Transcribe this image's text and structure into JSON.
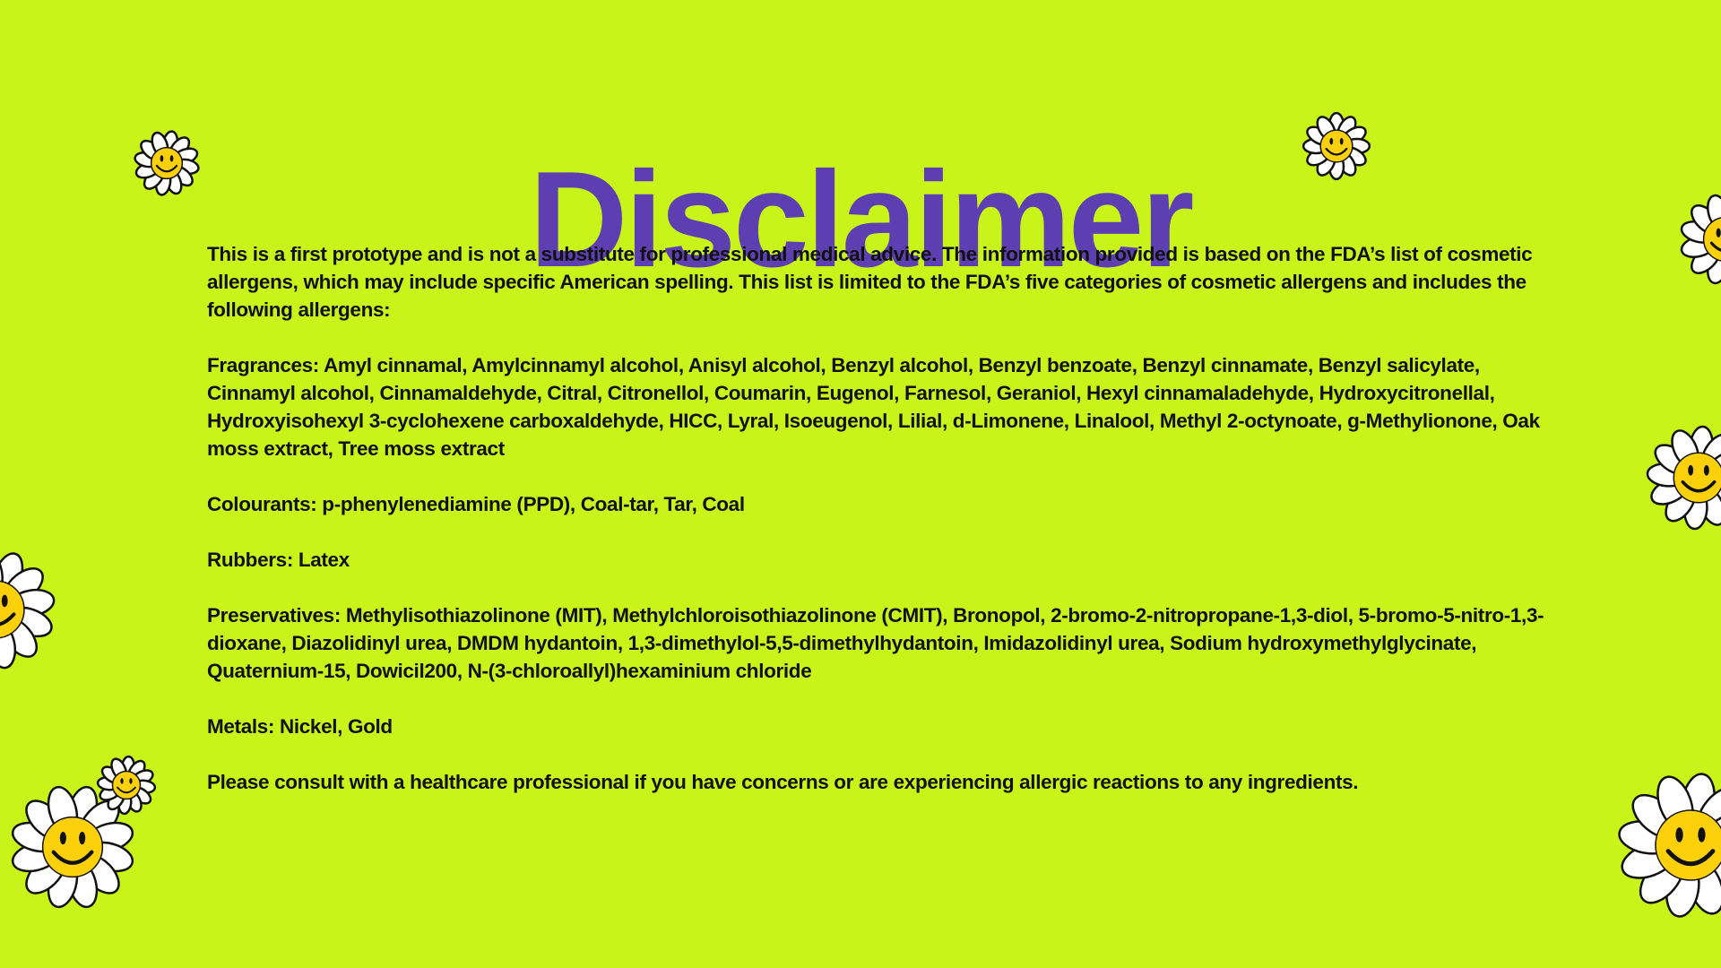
{
  "colors": {
    "background": "#c9f41a",
    "title": "#5d3fb2",
    "petal": "#ffffff",
    "outline": "#111111",
    "face": "#fcd10a"
  },
  "title": "Disclaimer",
  "paragraphs": [
    "This is a first prototype and is not a substitute for professional medical advice. The information provided is based on the FDA’s list of cosmetic allergens, which may include specific American spelling. This list is limited to the FDA’s five categories of cosmetic allergens and includes the following allergens:",
    "Fragrances: Amyl cinnamal, Amylcinnamyl alcohol, Anisyl alcohol, Benzyl alcohol, Benzyl benzoate, Benzyl cinnamate, Benzyl salicylate, Cinnamyl alcohol, Cinnamaldehyde, Citral, Citronellol, Coumarin, Eugenol, Farnesol, Geraniol, Hexyl cinnamaladehyde, Hydroxycitronellal, Hydroxyisohexyl 3-cyclohexene carboxaldehyde, HICC, Lyral, Isoeugenol, Lilial, d-Limonene, Linalool, Methyl 2-octynoate, g-Methylionone, Oak moss extract, Tree moss extract",
    "Colourants: p-phenylenediamine (PPD), Coal-tar, Tar, Coal",
    "Rubbers: Latex",
    "Preservatives: Methylisothiazolinone (MIT), Methylchloroisothiazolinone (CMIT), Bronopol, 2-bromo-2-nitropropane-1,3-diol, 5-bromo-5-nitro-1,3-dioxane, Diazolidinyl urea, DMDM hydantoin, 1,3-dimethylol-5,5-dimethylhydantoin, Imidazolidinyl urea, Sodium hydroxymethylglycinate, Quaternium-15, Dowicil200, N-(3-chloroallyl)hexaminium chloride",
    "Metals: Nickel, Gold",
    "Please consult with a healthcare professional if you have concerns or are experiencing allergic reactions to any ingredients."
  ],
  "decorations": {
    "icon": "smiley-daisy-icon",
    "count": 8
  }
}
